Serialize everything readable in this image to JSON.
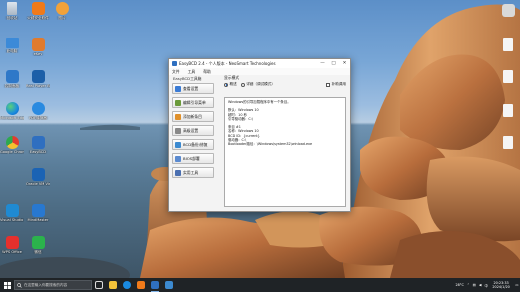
{
  "desktop_icons": [
    {
      "label": "回收站"
    },
    {
      "label": "火绒安全软件"
    },
    {
      "label": "图片"
    },
    {
      "label": "此电脑"
    },
    {
      "label": "eKey"
    },
    {
      "label": "控制面板"
    },
    {
      "label": "Real Player Best Cut"
    },
    {
      "label": "Microsoft Edge"
    },
    {
      "label": "PDF转换器"
    },
    {
      "label": "Google Chrome"
    },
    {
      "label": "EasyBCD"
    },
    {
      "label": "Oracle VM VirtualBox"
    },
    {
      "label": "Visual Studio Code"
    },
    {
      "label": "MindMaster"
    },
    {
      "label": "WPS Office"
    },
    {
      "label": "微信"
    }
  ],
  "window": {
    "title": "EasyBCD 2.4 - 个人版本 - NeoSmart Technologies",
    "controls": {
      "minimize": "—",
      "maximize": "□",
      "close": "✕"
    },
    "menu": [
      "文件",
      "工具",
      "帮助"
    ],
    "sidebar_heading": "EasyBCD工具箱",
    "sidebar": [
      "查看设置",
      "编辑引导菜单",
      "添加新条目",
      "高级设置",
      "BCD备份/修复",
      "BIOS部署",
      "实用工具"
    ],
    "section_title": "显示模式",
    "options": {
      "overview": "概述",
      "detailed": "详细（调试模式）",
      "debug": "补助调用"
    },
    "output": [
      "Windows的引导加载程序中有一个条目。",
      "",
      "默认：Windows 10",
      "超时：10 秒",
      "引导驱动器：C:\\",
      "",
      "条目 #1",
      "名称：Windows 10",
      "BCD ID：{current}",
      "驱动器：C:\\",
      "Bootloader路径：\\Windows\\system32\\winload.exe"
    ]
  },
  "taskbar": {
    "search_placeholder": "在这里输入你要搜索的内容",
    "tray": {
      "temp": "28°C",
      "lang": "中",
      "time": "20:23:33",
      "date": "2024/1/20"
    }
  },
  "colors": {
    "taskbar": "#1f2326",
    "accent": "#1a5fb4"
  }
}
